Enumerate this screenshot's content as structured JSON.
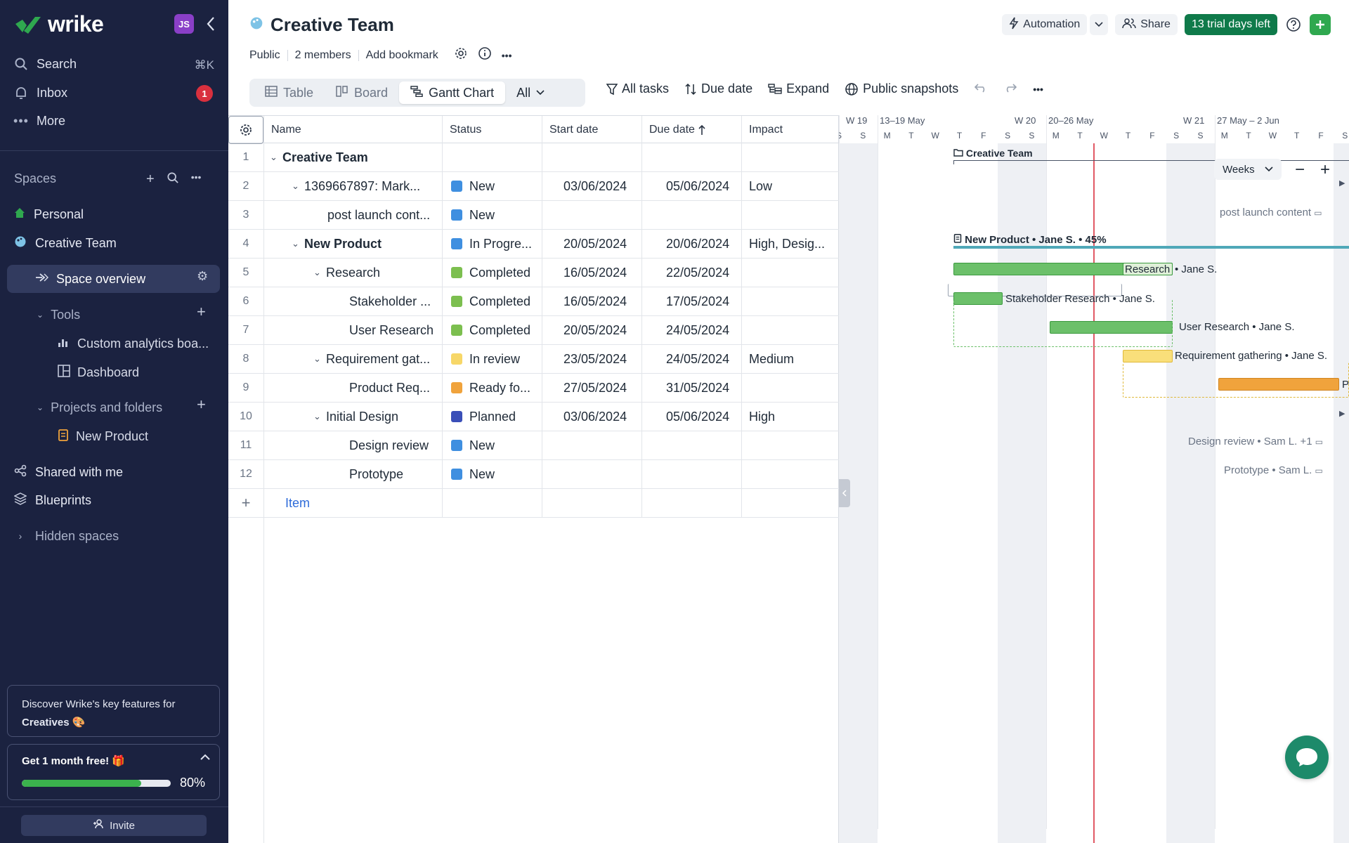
{
  "sidebar": {
    "logo_text": "wrike",
    "avatar_initials": "JS",
    "search_label": "Search",
    "search_shortcut": "⌘K",
    "inbox_label": "Inbox",
    "inbox_count": "1",
    "more_label": "More",
    "spaces_label": "Spaces",
    "personal_label": "Personal",
    "creative_team_label": "Creative Team",
    "space_overview_label": "Space overview",
    "tools_label": "Tools",
    "custom_analytics_label": "Custom analytics boa...",
    "dashboard_label": "Dashboard",
    "projects_label": "Projects and folders",
    "new_product_label": "New Product",
    "shared_label": "Shared with me",
    "blueprints_label": "Blueprints",
    "hidden_spaces_label": "Hidden spaces",
    "promo_line1": "Discover Wrike's key features for",
    "promo_line2": "Creatives 🎨",
    "trial_card_title": "Get 1 month free! 🎁",
    "trial_progress": 0.8,
    "trial_progress_label": "80%",
    "invite_label": "Invite"
  },
  "header": {
    "title": "Creative Team",
    "visibility": "Public",
    "members": "2 members",
    "add_bookmark": "Add bookmark",
    "automation_label": "Automation",
    "share_label": "Share",
    "trial_label": "13 trial days left"
  },
  "views": {
    "table": "Table",
    "board": "Board",
    "gantt": "Gantt Chart",
    "all": "All"
  },
  "toolbar": {
    "all_tasks": "All tasks",
    "due_date": "Due date",
    "expand": "Expand",
    "public_snapshots": "Public snapshots"
  },
  "table": {
    "headers": {
      "name": "Name",
      "status": "Status",
      "start": "Start date",
      "due": "Due date",
      "impact": "Impact"
    },
    "rows": [
      {
        "num": "1",
        "name": "Creative Team",
        "status": "",
        "start": "",
        "due": "",
        "impact": ""
      },
      {
        "num": "2",
        "name": "1369667897: Mark...",
        "status": "New",
        "start": "03/06/2024",
        "due": "05/06/2024",
        "impact": "Low"
      },
      {
        "num": "3",
        "name": "post launch cont...",
        "status": "New",
        "start": "",
        "due": "",
        "impact": ""
      },
      {
        "num": "4",
        "name": "New Product",
        "status": "In Progre...",
        "start": "20/05/2024",
        "due": "20/06/2024",
        "impact": "High, Desig..."
      },
      {
        "num": "5",
        "name": "Research",
        "status": "Completed",
        "start": "16/05/2024",
        "due": "22/05/2024",
        "impact": ""
      },
      {
        "num": "6",
        "name": "Stakeholder ...",
        "status": "Completed",
        "start": "16/05/2024",
        "due": "17/05/2024",
        "impact": ""
      },
      {
        "num": "7",
        "name": "User Research",
        "status": "Completed",
        "start": "20/05/2024",
        "due": "24/05/2024",
        "impact": ""
      },
      {
        "num": "8",
        "name": "Requirement gat...",
        "status": "In review",
        "start": "23/05/2024",
        "due": "24/05/2024",
        "impact": "Medium"
      },
      {
        "num": "9",
        "name": "Product Req...",
        "status": "Ready fo...",
        "start": "27/05/2024",
        "due": "31/05/2024",
        "impact": ""
      },
      {
        "num": "10",
        "name": "Initial Design",
        "status": "Planned",
        "start": "03/06/2024",
        "due": "05/06/2024",
        "impact": "High"
      },
      {
        "num": "11",
        "name": "Design review",
        "status": "New",
        "start": "",
        "due": "",
        "impact": ""
      },
      {
        "num": "12",
        "name": "Prototype",
        "status": "New",
        "start": "",
        "due": "",
        "impact": ""
      }
    ],
    "add_item": "Item"
  },
  "status_colors": {
    "new": "#3f8fe0",
    "in_progress": "#3f8fe0",
    "completed": "#7cbf4f",
    "in_review": "#f7d768",
    "ready": "#f0a33c",
    "planned": "#3a4fb8"
  },
  "gantt": {
    "week_labels": [
      "W 19",
      "13–19 May",
      "W 20",
      "20–26 May",
      "W 21",
      "27 May – 2 Jun"
    ],
    "day_labels": [
      "S",
      "S",
      "M",
      "T",
      "W",
      "T",
      "F",
      "S",
      "S",
      "M",
      "T",
      "W",
      "T",
      "F",
      "S",
      "S",
      "M",
      "T",
      "W",
      "T",
      "F",
      "S"
    ],
    "weeks_label": "Weeks",
    "project_label": "Creative Team",
    "new_product_label": "New Product • Jane S. • 45%",
    "research_label": "Research",
    "research_assignee": "• Jane S.",
    "stakeholder_label": "Stakeholder Research • Jane S.",
    "user_research_label": "User Research • Jane S.",
    "requirement_label": "Requirement gathering • Jane S.",
    "product_req_label": "P",
    "post_launch_label": "post launch content",
    "design_review_label": "Design review • Sam L. +1",
    "prototype_label": "Prototype • Sam L."
  }
}
